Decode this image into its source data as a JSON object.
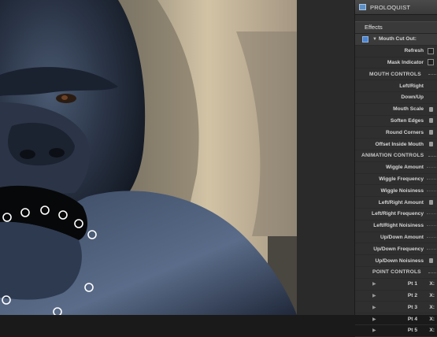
{
  "panel": {
    "title": "PROLOQUIST",
    "effects_header": "Effects",
    "effect_name": "Mouth Cut Out:",
    "rows_top": [
      {
        "label": "Refresh",
        "control": "checkbox"
      },
      {
        "label": "Mask Indicator",
        "control": "checkbox"
      }
    ],
    "section_mouth": "MOUTH CONTROLS",
    "mouth_rows": [
      {
        "label": "Left/Right",
        "control": "none"
      },
      {
        "label": "Down/Up",
        "control": "none"
      },
      {
        "label": "Mouth Scale",
        "control": "slider"
      },
      {
        "label": "Soften Edges",
        "control": "slider"
      },
      {
        "label": "Round Corners",
        "control": "slider"
      },
      {
        "label": "Offset Inside Mouth",
        "control": "slider"
      }
    ],
    "section_animation": "ANIMATION CONTROLS",
    "anim_rows": [
      {
        "label": "Wiggle Amount",
        "control": "line"
      },
      {
        "label": "Wiggle Frequency",
        "control": "line"
      },
      {
        "label": "Wiggle Noisiness",
        "control": "line"
      },
      {
        "label": "Left/Right Amount",
        "control": "slider"
      },
      {
        "label": "Left/Right Frequency",
        "control": "line"
      },
      {
        "label": "Left/Right Noisiness",
        "control": "line"
      },
      {
        "label": "Up/Down Amount",
        "control": "line"
      },
      {
        "label": "Up/Down Frequency",
        "control": "line"
      },
      {
        "label": "Up/Down Noisiness",
        "control": "slider"
      }
    ],
    "section_point": "POINT CONTROLS",
    "point_rows": [
      {
        "label": "Pt 1",
        "axis": "X:"
      },
      {
        "label": "Pt 2",
        "axis": "X:"
      },
      {
        "label": "Pt 3",
        "axis": "X:"
      },
      {
        "label": "Pt 4",
        "axis": "X:"
      },
      {
        "label": "Pt 5",
        "axis": "X:"
      }
    ]
  }
}
